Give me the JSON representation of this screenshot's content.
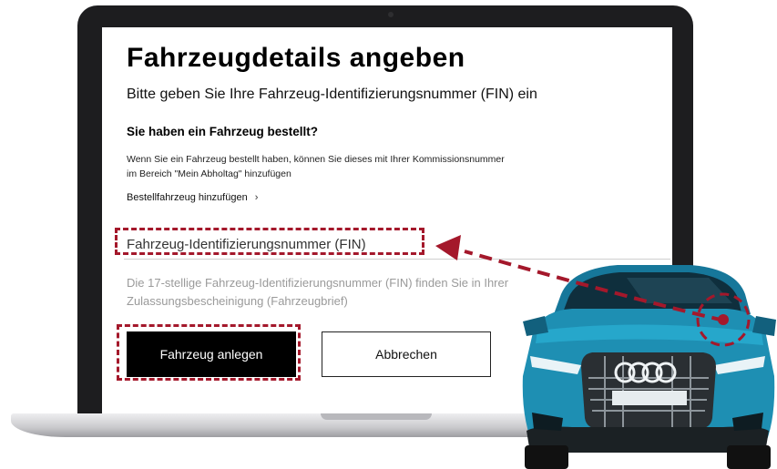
{
  "page": {
    "title": "Fahrzeugdetails angeben",
    "subtitle": "Bitte geben Sie Ihre Fahrzeug-Identifizierungsnummer (FIN) ein"
  },
  "order_section": {
    "heading": "Sie haben ein Fahrzeug bestellt?",
    "text": "Wenn Sie ein Fahrzeug bestellt haben, können Sie dieses mit Ihrer Kommissionsnummer im Bereich \"Mein Abholtag\" hinzufügen",
    "link_label": "Bestellfahrzeug hinzufügen",
    "link_icon": "chevron-right-icon"
  },
  "fin_field": {
    "label": "Fahrzeug-Identifizierungsnummer (FIN)",
    "value": "",
    "help": "Die 17-stellige Fahrzeug-Identifizierungsnummer (FIN) finden Sie in Ihrer Zulassungsbescheinigung (Fahrzeugbrief)"
  },
  "buttons": {
    "primary_label": "Fahrzeug anlegen",
    "secondary_label": "Abbrechen"
  },
  "colors": {
    "annotation": "#a4182b",
    "primary_button": "#000000",
    "car_body": "#1e8fb3"
  }
}
